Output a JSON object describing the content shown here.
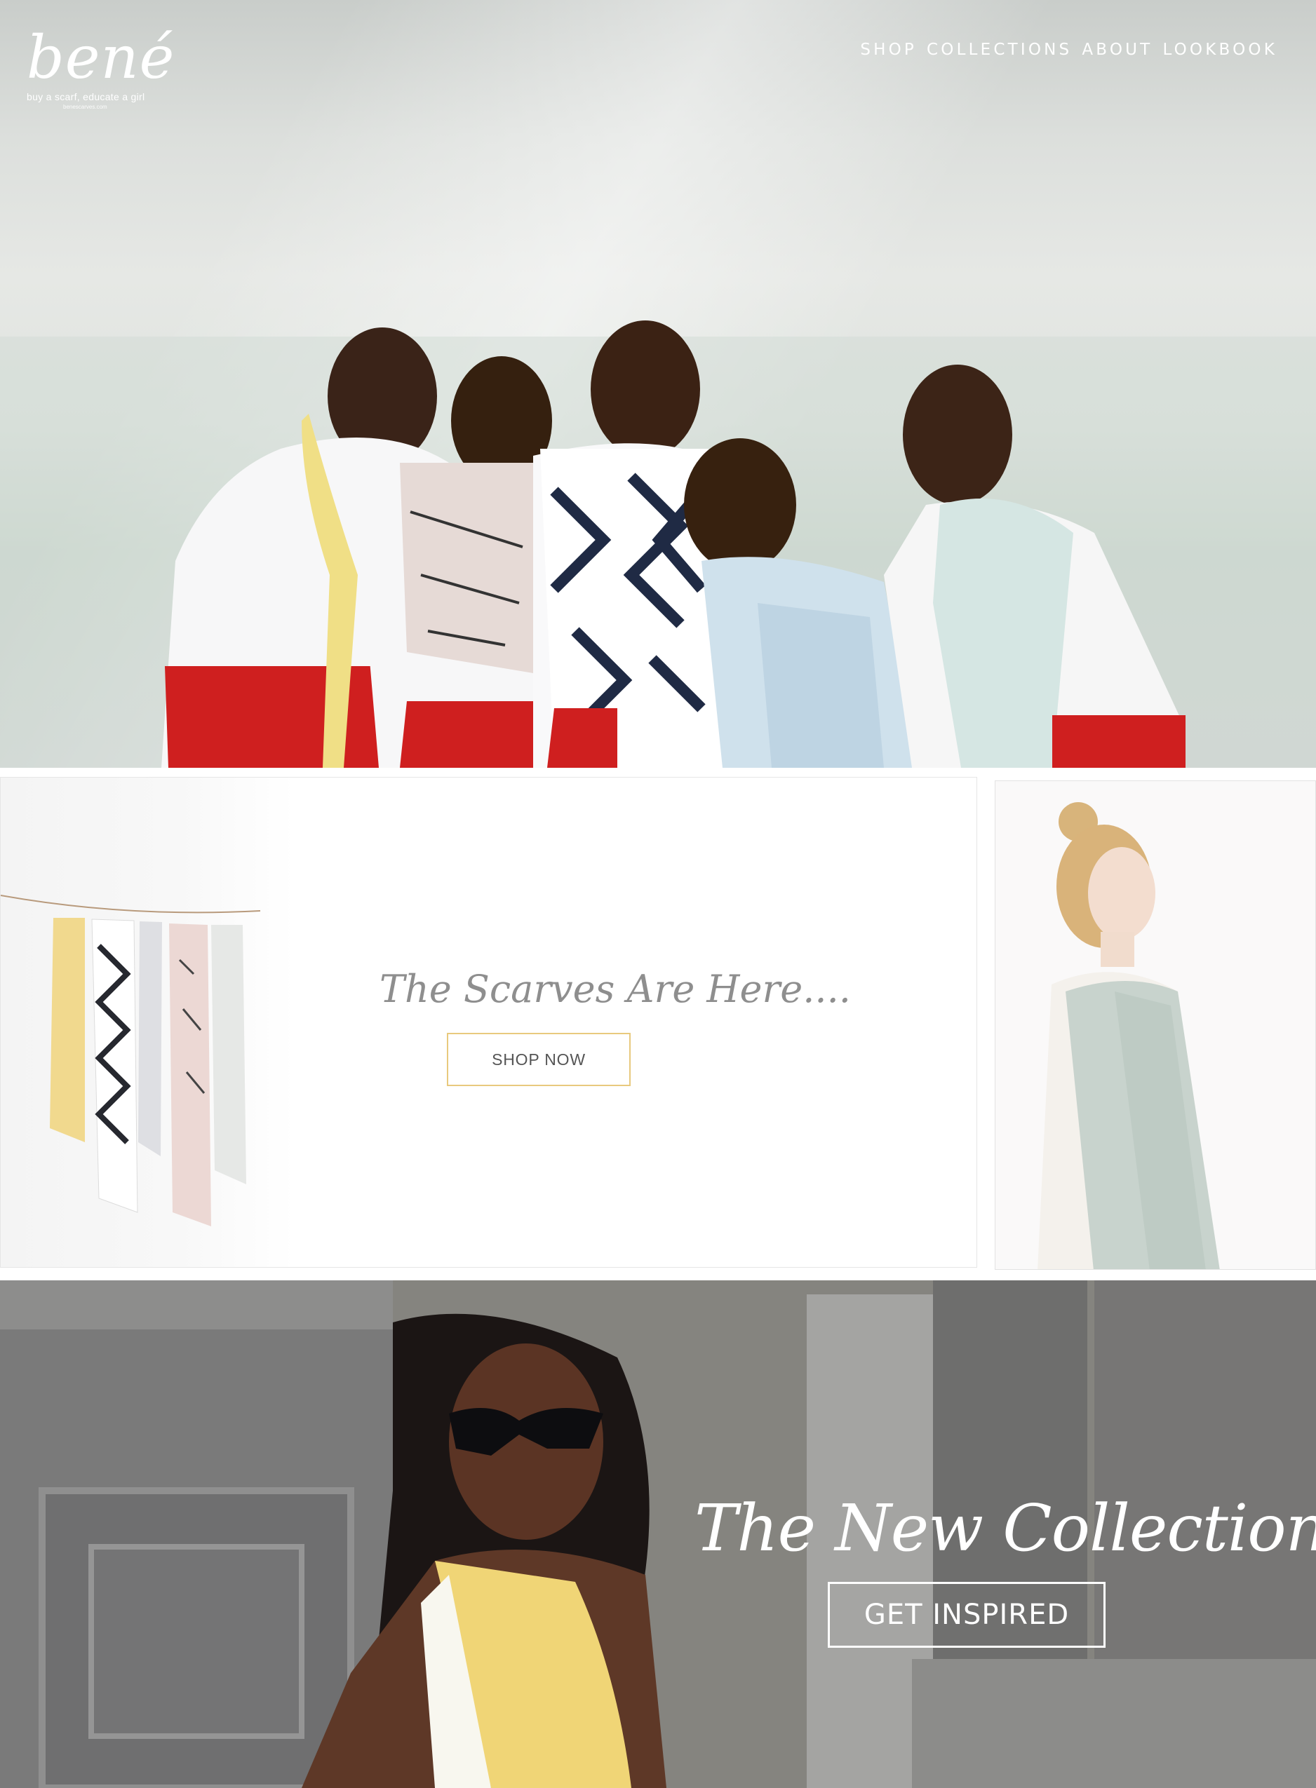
{
  "brand": {
    "logo_text": "bené",
    "tagline": "buy a scarf, educate a girl",
    "url_text": "benescarves.com"
  },
  "nav": {
    "items": [
      {
        "label": "SHOP"
      },
      {
        "label": "COLLECTIONS"
      },
      {
        "label": "ABOUT"
      },
      {
        "label": "LOOKBOOK"
      }
    ]
  },
  "hero": {
    "image": "group-of-five-smiling-schoolgirls-wearing-scarves"
  },
  "promo": {
    "image": "scarves-hanging-on-line",
    "title": "The Scarves Are Here....",
    "button_label": "SHOP NOW"
  },
  "side_image": {
    "image": "blonde-woman-with-mint-scarf"
  },
  "banner": {
    "image": "woman-in-sunglasses-with-yellow-scarf",
    "title": "The New Collection",
    "button_label": "GET INSPIRED"
  },
  "colors": {
    "accent_border": "#e8c97d",
    "promo_text": "#8e8e8e",
    "white": "#ffffff"
  }
}
